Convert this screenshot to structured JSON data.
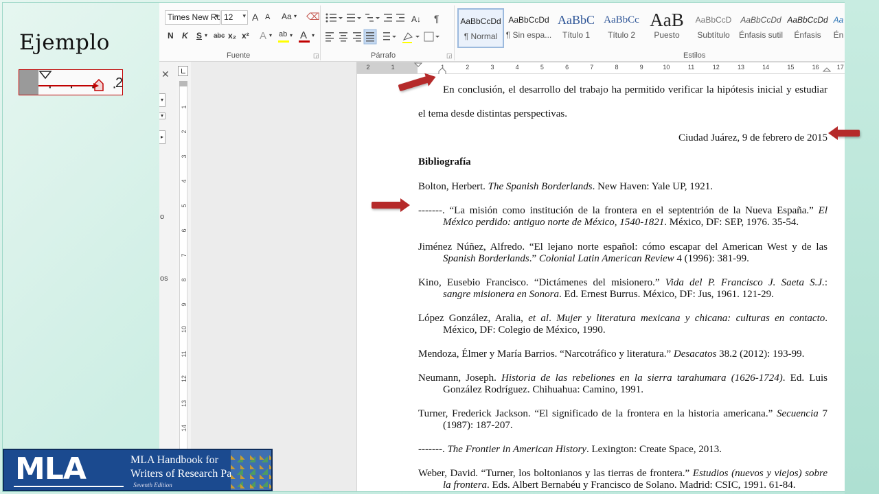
{
  "slide": {
    "title": "Ejemplo",
    "badge": {
      "letters": "MLA",
      "line1": "MLA Handbook for",
      "line2": "Writers of Research Papers",
      "edition": "Seventh Edition"
    }
  },
  "ribbon": {
    "font_name": "Times New Ro",
    "font_size": "12",
    "group_font_label": "Fuente",
    "group_paragraph_label": "Párrafo",
    "group_styles_label": "Estilos",
    "font_buttons": {
      "grow": "A",
      "shrink": "A",
      "case": "Aa",
      "bold": "N",
      "italic": "K",
      "underline": "S",
      "strike": "abc",
      "subscript": "x₂",
      "superscript": "x²",
      "text_effects": "A",
      "highlight": "ab",
      "font_color": "A"
    },
    "styles": [
      {
        "sample": "AaBbCcDd",
        "name": "¶ Normal"
      },
      {
        "sample": "AaBbCcDd",
        "name": "¶ Sin espa..."
      },
      {
        "sample": "AaBbC",
        "name": "Título 1"
      },
      {
        "sample": "AaBbCc",
        "name": "Título 2"
      },
      {
        "sample": "AaB",
        "name": "Puesto"
      },
      {
        "sample": "AaBbCcD",
        "name": "Subtítulo"
      },
      {
        "sample": "AaBbCcDd",
        "name": "Énfasis sutil"
      },
      {
        "sample": "AaBbCcDd",
        "name": "Énfasis"
      },
      {
        "sample": "Aa",
        "name": "Én"
      }
    ],
    "colors": {
      "highlight": "#ffff00",
      "font_color": "#c00000",
      "accent": "#2b579a"
    }
  },
  "rulers": {
    "horizontal": [
      "2",
      "1",
      "",
      "1",
      "2",
      "3",
      "4",
      "5",
      "6",
      "7",
      "8",
      "9",
      "10",
      "11",
      "12",
      "13",
      "14",
      "15",
      "16",
      "17"
    ],
    "vertical": [
      "1",
      "2",
      "3",
      "4",
      "5",
      "6",
      "7",
      "8",
      "9",
      "10",
      "11",
      "12",
      "13",
      "14",
      "15"
    ]
  },
  "nav_pane": {
    "close": "✕",
    "fragments": [
      "o",
      "os"
    ]
  },
  "document": {
    "p1_line1": "En conclusión, el desarrollo del trabajo ha permitido verificar la hipótesis inicial y estudiar",
    "p1_line2": "el tema desde distintas perspectivas.",
    "date_line": "Ciudad Juárez, 9 de febrero de 2015",
    "bib_heading": "Bibliografía",
    "entries": [
      {
        "lines": [
          {
            "parts": [
              {
                "t": "Bolton, Herbert. "
              },
              {
                "t": "The Spanish Borderlands",
                "i": true
              },
              {
                "t": ". New Haven: Yale UP, 1921."
              }
            ]
          }
        ]
      },
      {
        "lines": [
          {
            "parts": [
              {
                "t": "-------. “La misión como institución de la frontera en el septentrión de la Nueva España.” "
              },
              {
                "t": "El",
                "i": true
              }
            ]
          },
          {
            "parts": [
              {
                "t": "México perdido: antiguo norte de México, 1540-1821",
                "i": true
              },
              {
                "t": ". México, DF: SEP, 1976. 35-54."
              }
            ]
          }
        ]
      },
      {
        "lines": [
          {
            "parts": [
              {
                "t": "Jiménez Núñez, Alfredo. “El lejano norte español: cómo escapar del American West y de las"
              }
            ]
          },
          {
            "parts": [
              {
                "t": "Spanish Borderlands",
                "i": true
              },
              {
                "t": ".” "
              },
              {
                "t": "Colonial Latin American Review",
                "i": true
              },
              {
                "t": " 4 (1996): 381-99."
              }
            ]
          }
        ]
      },
      {
        "lines": [
          {
            "parts": [
              {
                "t": "Kino, Eusebio Francisco. “Dictámenes del misionero.” "
              },
              {
                "t": "Vida del P. Francisco J. Saeta S.J.",
                "i": true
              },
              {
                "t": ":"
              }
            ]
          },
          {
            "parts": [
              {
                "t": "sangre misionera en Sonora",
                "i": true
              },
              {
                "t": ". Ed. Ernest Burrus. México, DF: Jus, 1961. 121-29."
              }
            ]
          }
        ]
      },
      {
        "lines": [
          {
            "parts": [
              {
                "t": "López González, Aralia, "
              },
              {
                "t": "et al",
                "i": true
              },
              {
                "t": ". "
              },
              {
                "t": "Mujer y literatura mexicana y chicana: culturas en contacto",
                "i": true
              },
              {
                "t": "."
              }
            ]
          },
          {
            "parts": [
              {
                "t": "México, DF: Colegio de México, 1990."
              }
            ]
          }
        ]
      },
      {
        "lines": [
          {
            "parts": [
              {
                "t": "Mendoza, Élmer y María Barrios. “Narcotráfico y literatura.” "
              },
              {
                "t": "Desacatos",
                "i": true
              },
              {
                "t": " 38.2 (2012): 193-99."
              }
            ]
          }
        ]
      },
      {
        "lines": [
          {
            "parts": [
              {
                "t": "Neumann, Joseph. "
              },
              {
                "t": "Historia de las rebeliones en la sierra tarahumara (1626-1724)",
                "i": true
              },
              {
                "t": ". Ed. Luis"
              }
            ]
          },
          {
            "parts": [
              {
                "t": "González Rodríguez. Chihuahua: Camino, 1991."
              }
            ]
          }
        ]
      },
      {
        "lines": [
          {
            "parts": [
              {
                "t": "Turner, Frederick Jackson. “El significado de la frontera en la historia americana.” "
              },
              {
                "t": "Secuencia",
                "i": true
              },
              {
                "t": " 7"
              }
            ]
          },
          {
            "parts": [
              {
                "t": "(1987): 187-207."
              }
            ]
          }
        ]
      },
      {
        "lines": [
          {
            "parts": [
              {
                "t": "-------. "
              },
              {
                "t": "The Frontier in American History",
                "i": true
              },
              {
                "t": ". Lexington: Create Space, 2013."
              }
            ]
          }
        ]
      },
      {
        "lines": [
          {
            "parts": [
              {
                "t": "Weber, David. “Turner, los boltonianos y las tierras de frontera.” "
              },
              {
                "t": "Estudios (nuevos y viejos) sobre",
                "i": true
              }
            ]
          },
          {
            "parts": [
              {
                "t": "la frontera",
                "i": true
              },
              {
                "t": ". Eds. Albert Bernabéu y Francisco de Solano. Madrid: CSIC, 1991. 61-84."
              }
            ]
          }
        ]
      }
    ]
  }
}
